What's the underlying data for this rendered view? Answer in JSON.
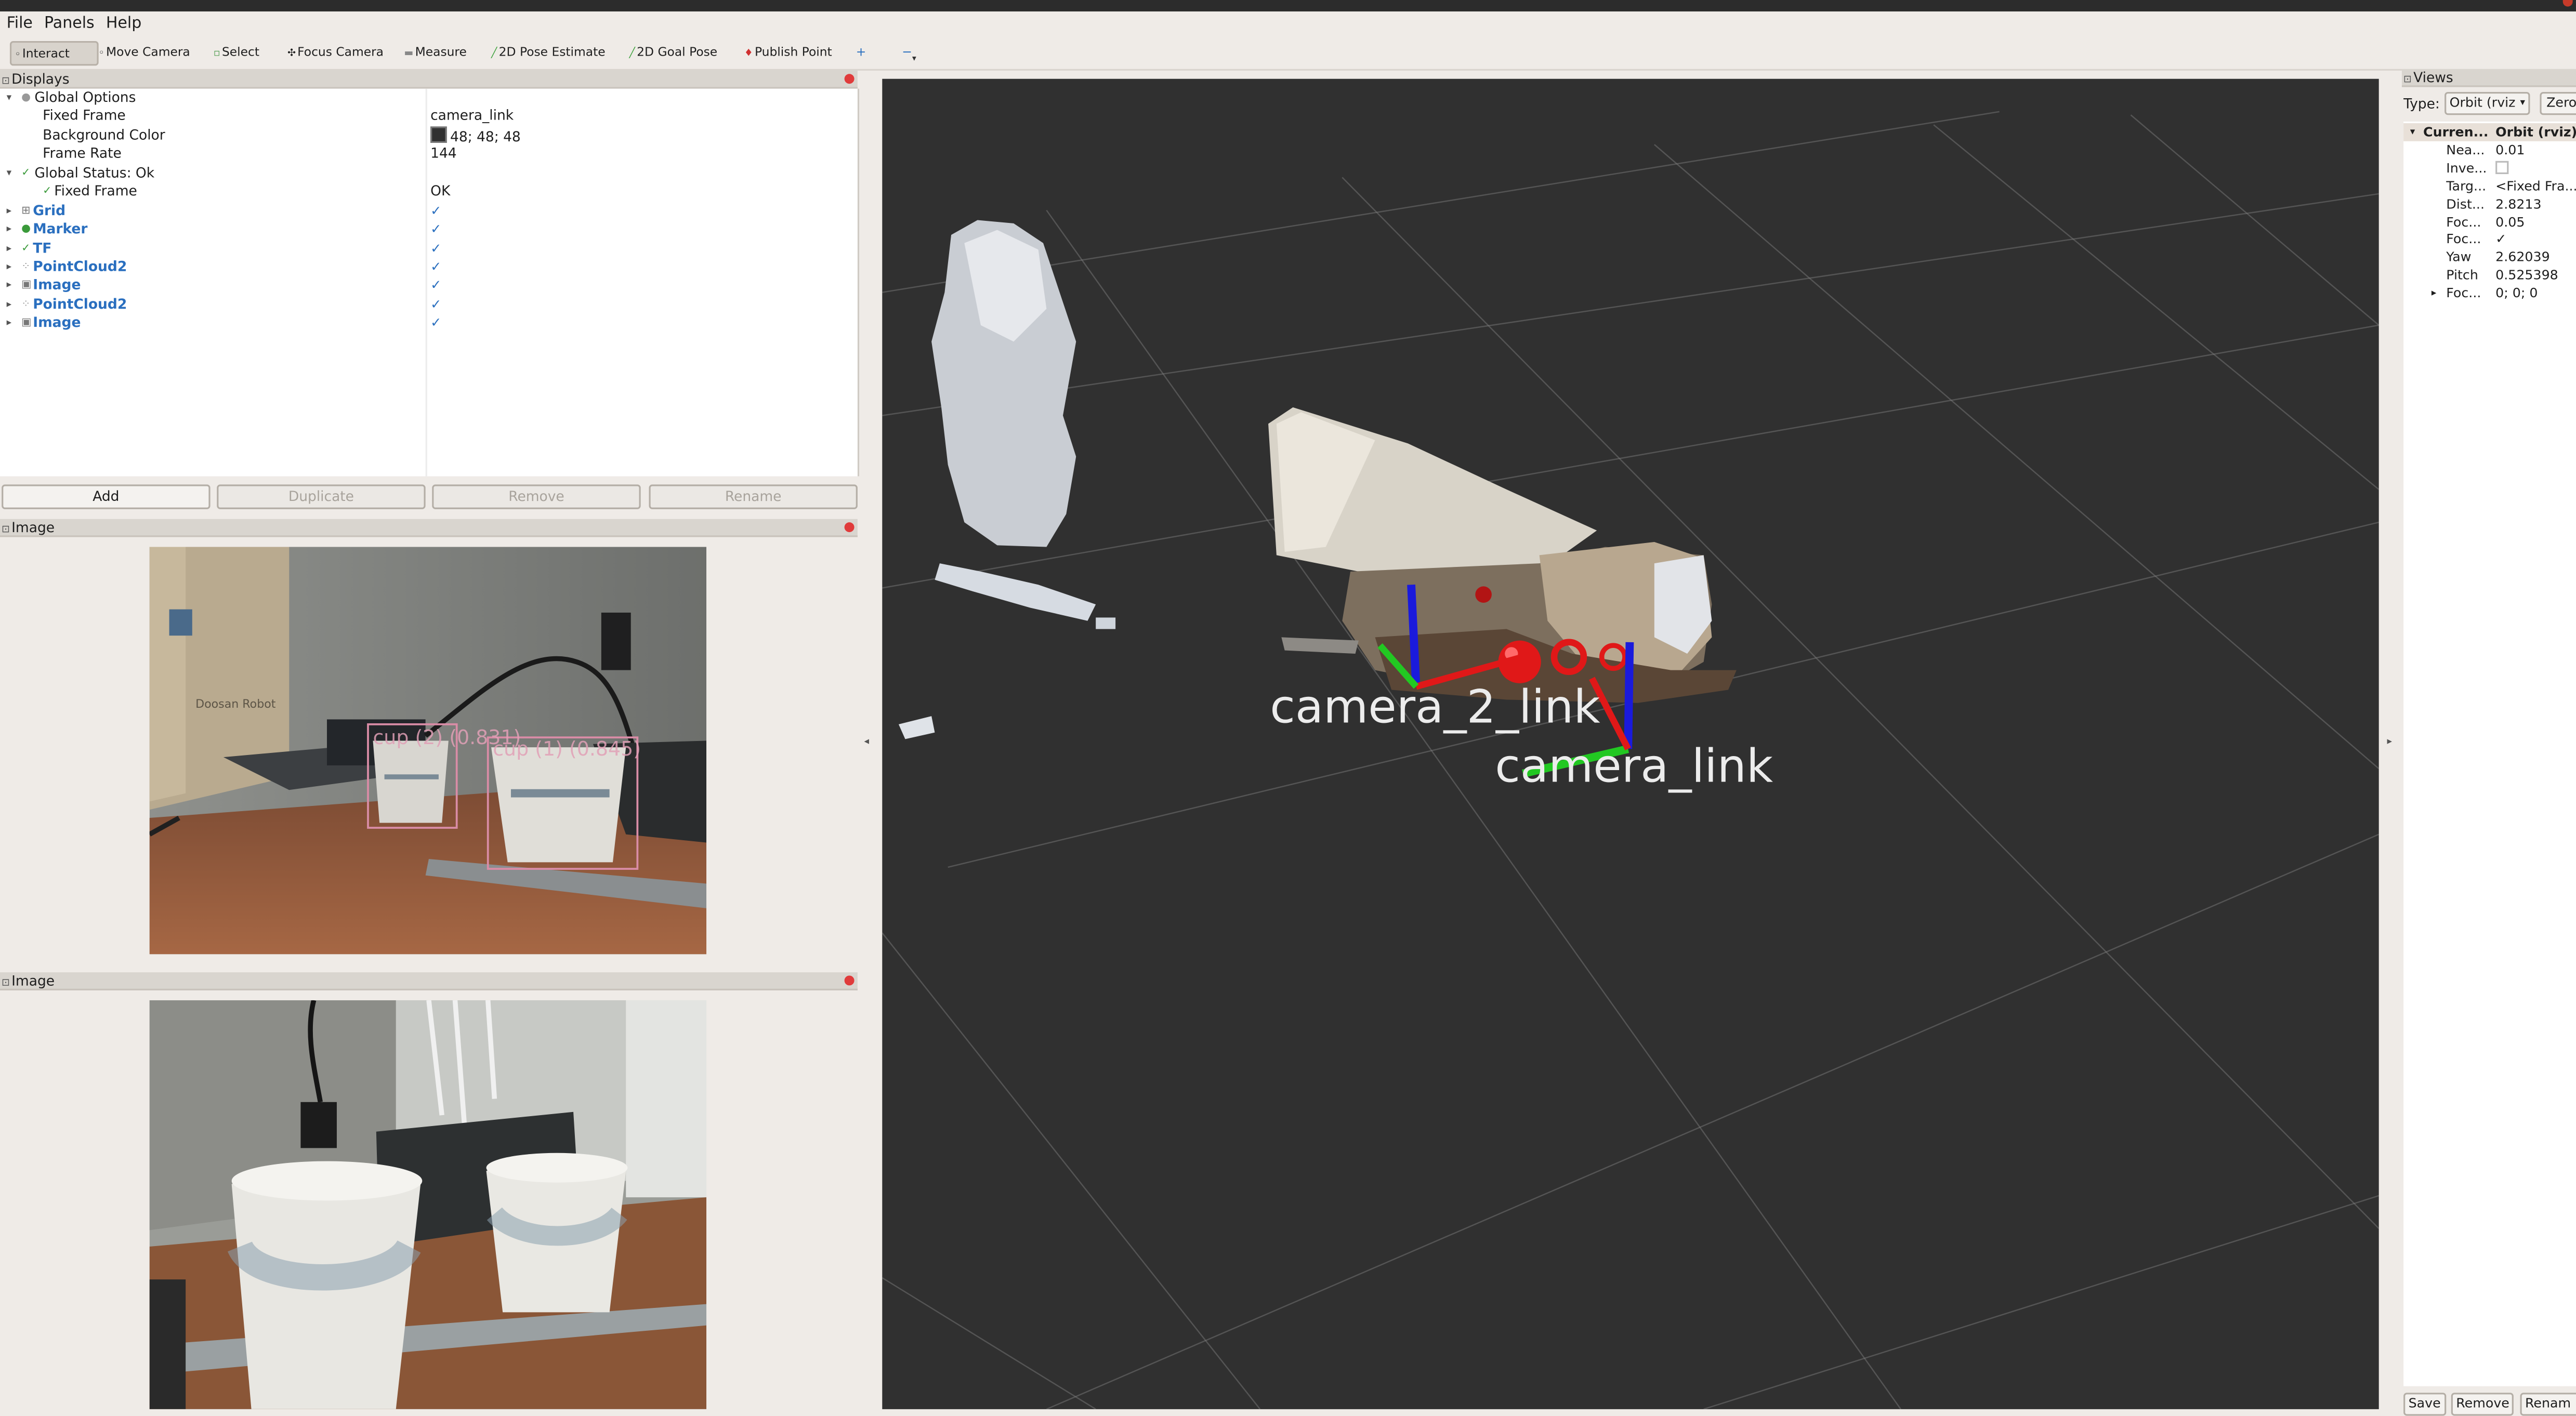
{
  "menu": {
    "file": "File",
    "panels": "Panels",
    "help": "Help"
  },
  "toolbar": {
    "interact": "Interact",
    "move_camera": "Move Camera",
    "select": "Select",
    "focus_camera": "Focus Camera",
    "measure": "Measure",
    "pose_estimate": "2D Pose Estimate",
    "goal_pose": "2D Goal Pose",
    "publish_point": "Publish Point"
  },
  "displays": {
    "title": "Displays",
    "global_options": "Global Options",
    "fixed_frame_label": "Fixed Frame",
    "fixed_frame_value": "camera_link",
    "background_color_label": "Background Color",
    "background_color_value": "48; 48; 48",
    "background_color_hex": "#303030",
    "frame_rate_label": "Frame Rate",
    "frame_rate_value": "144",
    "global_status": "Global Status: Ok",
    "status_fixed_frame_label": "Fixed Frame",
    "status_fixed_frame_value": "OK",
    "items": [
      {
        "label": "Grid",
        "checked": "✓"
      },
      {
        "label": "Marker",
        "checked": "✓"
      },
      {
        "label": "TF",
        "checked": "✓"
      },
      {
        "label": "PointCloud2",
        "checked": "✓"
      },
      {
        "label": "Image",
        "checked": "✓"
      },
      {
        "label": "PointCloud2",
        "checked": "✓"
      },
      {
        "label": "Image",
        "checked": "✓"
      }
    ],
    "buttons": {
      "add": "Add",
      "duplicate": "Duplicate",
      "remove": "Remove",
      "rename": "Rename"
    }
  },
  "image_panel_1": {
    "title": "Image",
    "detections": [
      {
        "label": "cup (2) (0.831)"
      },
      {
        "label": "cup (1) (0.845)"
      }
    ],
    "box_text": "Doosan Robot"
  },
  "image_panel_2": {
    "title": "Image"
  },
  "view3d": {
    "frames": [
      "camera_2_link",
      "camera_link"
    ]
  },
  "views": {
    "title": "Views",
    "type_label": "Type:",
    "type_value": "Orbit (rviz",
    "zero_label": "Zero",
    "header_name": "Curren...",
    "header_value": "Orbit (rviz)",
    "props": [
      {
        "k": "Nea...",
        "v": "0.01"
      },
      {
        "k": "Inve...",
        "v": ""
      },
      {
        "k": "Targ...",
        "v": "<Fixed Fra..."
      },
      {
        "k": "Dist...",
        "v": "2.8213"
      },
      {
        "k": "Foc...",
        "v": "0.05"
      },
      {
        "k": "Foc...",
        "v": "✓"
      },
      {
        "k": "Yaw",
        "v": "2.62039"
      },
      {
        "k": "Pitch",
        "v": "0.525398"
      },
      {
        "k": "Foc...",
        "v": "0; 0; 0"
      }
    ],
    "buttons": {
      "save": "Save",
      "remove": "Remove",
      "rename": "Renam"
    }
  },
  "colors": {
    "accent_blue": "#2a6fbf",
    "viewport_bg": "#303030",
    "close_red": "#e03b3b",
    "detection_box": "#d98ca6"
  }
}
